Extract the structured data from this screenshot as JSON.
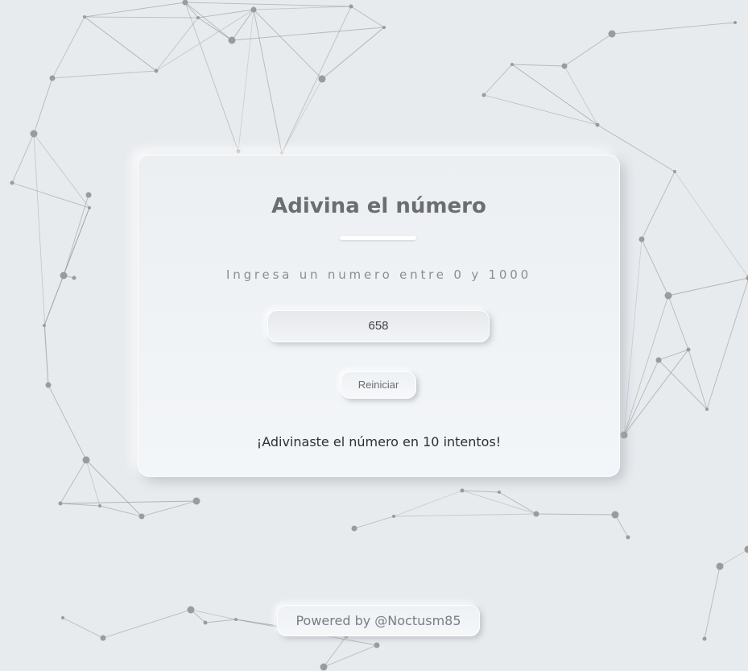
{
  "game": {
    "title": "Adivina el número",
    "instruction": "Ingresa un numero entre 0 y 1000",
    "guess_value": "658",
    "restart_label": "Reiniciar",
    "result_message": "¡Adivinaste el número en 10 intentos!"
  },
  "footer": {
    "credit": "Powered by @Noctusm85"
  },
  "colors": {
    "background": "#e8ebee",
    "network_line": "#9a9da1",
    "network_node": "#9b9b9b",
    "title": "#6b6d70"
  }
}
